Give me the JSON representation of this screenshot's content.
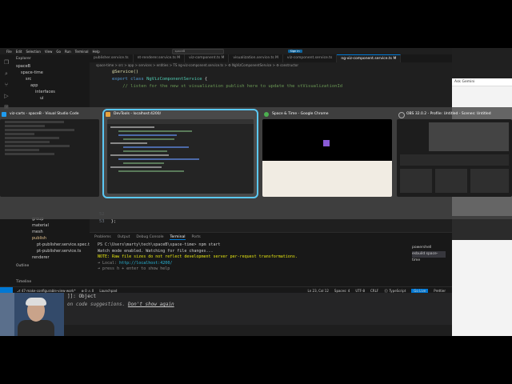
{
  "vscode": {
    "menu": [
      "File",
      "Edit",
      "Selection",
      "View",
      "Go",
      "Run",
      "Terminal",
      "Help"
    ],
    "search": "spaceB",
    "sign_in": "Sign in",
    "explorer_title": "Explorer",
    "tree_top": [
      "spaceB",
      "space-time",
      "src",
      "app",
      "interfaces",
      "ui"
    ],
    "tree_bottom": [
      "group",
      "material",
      "mesh",
      "publish",
      "pt-publisher.service.spec.ts",
      "pt-publisher.service.ts",
      "renderer"
    ],
    "outline": "Outline",
    "timeline": "Timeline",
    "tabs": [
      "publisher.service.ts",
      "nt-renderer.service.ts M",
      "viz-component.ts M",
      "visualization.service.ts M",
      "viz-component.service.ts",
      "ng-viz-component.service.ts M"
    ],
    "breadcrumb": "space-time > src > app > services > entities > TS ng-viz-component.service.ts > ⚙ NgVizComponentService > ⚙ constructor",
    "code": {
      "line1_a": "@Service()",
      "line2_kw": "export class",
      "line2_cls": "NgVizComponentService",
      "line2_end": "{",
      "line3": "// listen for the new st visualization publish here to update the stVisualizationId",
      "line_last": "};"
    },
    "panel_tabs": [
      "Problems",
      "Output",
      "Debug Console",
      "Terminal",
      "Ports"
    ],
    "terminal": {
      "prompt": "PS C:\\Users\\marty\\tech\\spaceB\\space-time> npm start",
      "line2": "Watch mode enabled. Watching for file changes...",
      "line3": "NOTE: Raw file sizes do not reflect development server per-request transformations.",
      "local_label": "➜  Local:",
      "local_url": "http://localhost:4200/",
      "help": "➜  press h + enter to show help"
    },
    "terminal_list": [
      "powershell",
      "esbuild space-time"
    ],
    "status_left": [
      "⎇ 47-make-configurable-view-work*",
      "⊗ 0 ⚠ 0",
      "Launchpad"
    ],
    "status_right": [
      "Ln 23, Col 12",
      "Spaces: 4",
      "UTF-8",
      "CRLF",
      "{} TypeScript",
      "Go Live",
      "Prettier"
    ],
    "below_line1": "]]: Object",
    "below_suggestion": "on code suggestions.",
    "below_link": "Don't show again",
    "line_numbers": [
      "52",
      "53"
    ]
  },
  "switcher": {
    "cards": [
      {
        "title": "viz-carts - spaceB - Visual Studio Code",
        "icon_color": "#1f9cf0"
      },
      {
        "title": "DevTools - localhost:4200/",
        "icon_color": "#e8a33d"
      },
      {
        "title": "Space & Time - Google Chrome",
        "icon_color": "#4caf50"
      },
      {
        "title": "OBS 32.0.2 - Profile: Untitled - Scenes: Untitled",
        "icon_color": "#444444"
      }
    ]
  },
  "right_app": {
    "ask": "Ask Gemini"
  }
}
